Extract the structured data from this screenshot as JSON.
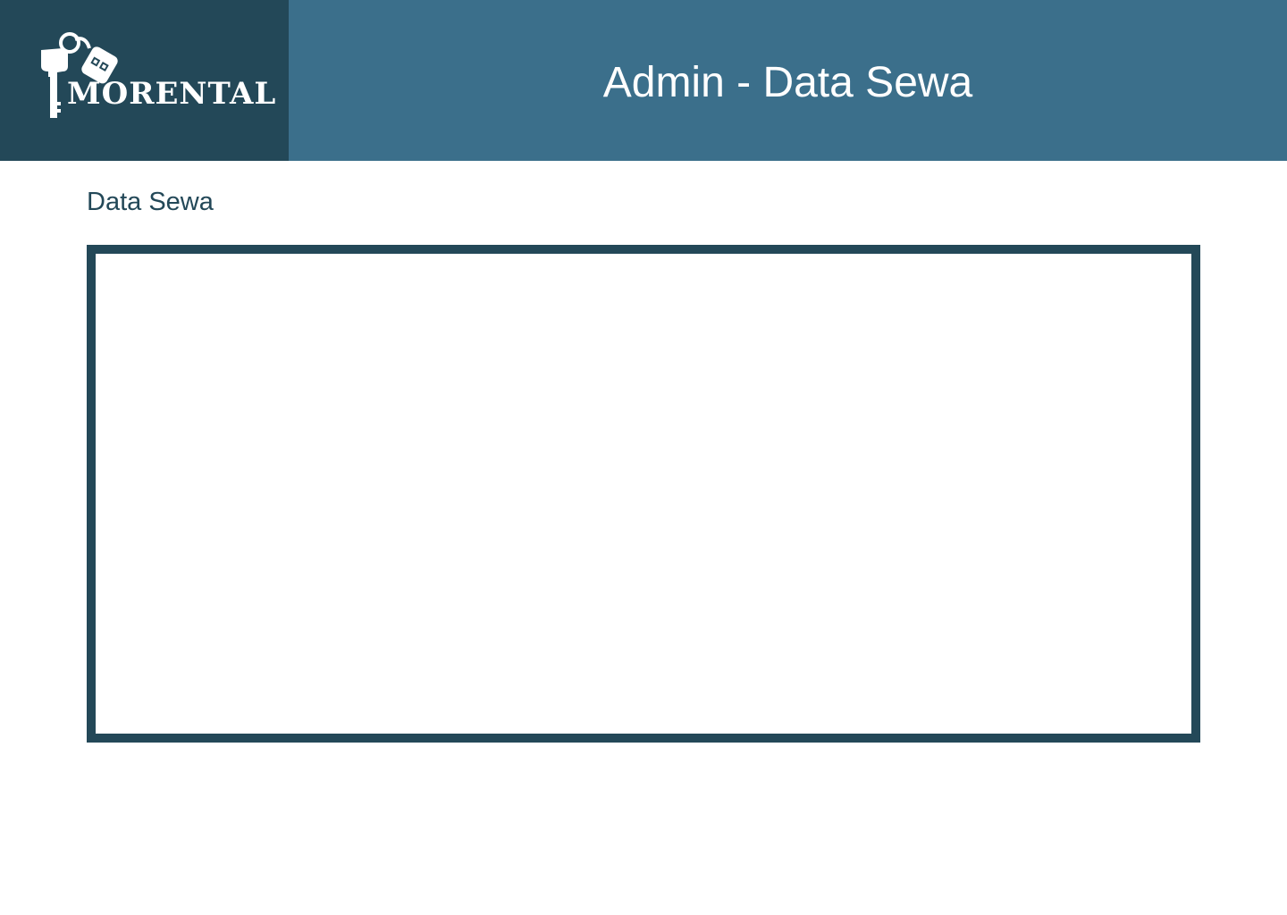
{
  "brand": {
    "logo_text": "MORENTAL",
    "logo_icon": "car-keys-icon",
    "colors": {
      "dark": "#234858",
      "accent": "#3b6f8b",
      "text_on_dark": "#ffffff"
    }
  },
  "header": {
    "title": "Admin - Data Sewa"
  },
  "main": {
    "section_title": "Data Sewa"
  }
}
